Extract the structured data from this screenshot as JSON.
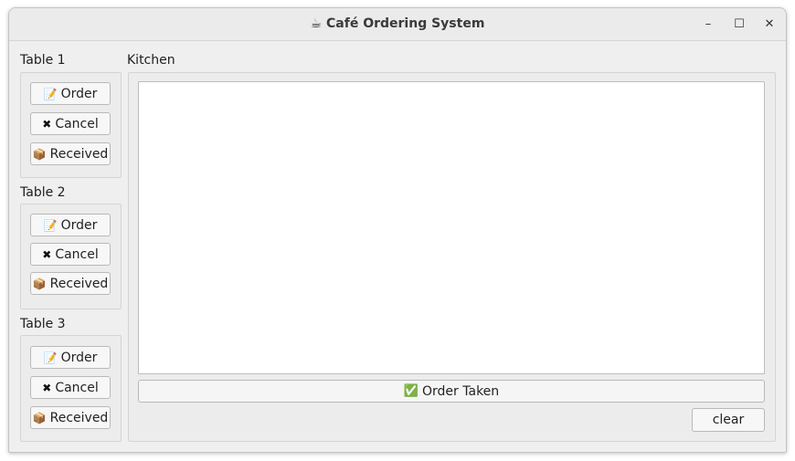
{
  "window": {
    "title": "☕ Café Ordering System",
    "controls": {
      "minimize": "–",
      "maximize": "☐",
      "close": "✕"
    }
  },
  "tables": [
    {
      "label": "Table 1",
      "buttons": {
        "order": "Order",
        "cancel": "Cancel",
        "received": "Received"
      }
    },
    {
      "label": "Table 2",
      "buttons": {
        "order": "Order",
        "cancel": "Cancel",
        "received": "Received"
      }
    },
    {
      "label": "Table 3",
      "buttons": {
        "order": "Order",
        "cancel": "Cancel",
        "received": "Received"
      }
    }
  ],
  "icons": {
    "order": "memo-icon",
    "cancel": "x-mark-icon",
    "received": "package-icon",
    "order_taken": "check-icon"
  },
  "kitchen": {
    "label": "Kitchen",
    "text": "",
    "order_taken_label": "Order Taken",
    "clear_label": "clear"
  }
}
